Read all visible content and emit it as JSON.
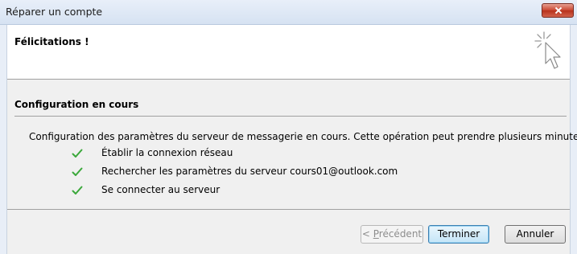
{
  "window": {
    "title": "Réparer un compte"
  },
  "header": {
    "title": "Félicitations !",
    "icon": "cursor-sparkle-icon"
  },
  "section": {
    "title": "Configuration en cours",
    "description": "Configuration des paramètres du serveur de messagerie en cours. Cette opération peut prendre plusieurs minutes :"
  },
  "steps": [
    {
      "label": "Établir la connexion réseau",
      "status": "done",
      "icon": "checkmark-icon"
    },
    {
      "label": "Rechercher les paramètres du serveur cours01@outlook.com",
      "status": "done",
      "icon": "checkmark-icon"
    },
    {
      "label": "Se connecter au serveur",
      "status": "done",
      "icon": "checkmark-icon"
    }
  ],
  "buttons": {
    "prev_prefix": "< ",
    "prev_accel": "P",
    "prev_rest": "récédent",
    "finish": "Terminer",
    "cancel": "Annuler"
  },
  "colors": {
    "check": "#3aa83a",
    "close_button": "#c8452f",
    "titlebar": "#dbe6f4"
  }
}
